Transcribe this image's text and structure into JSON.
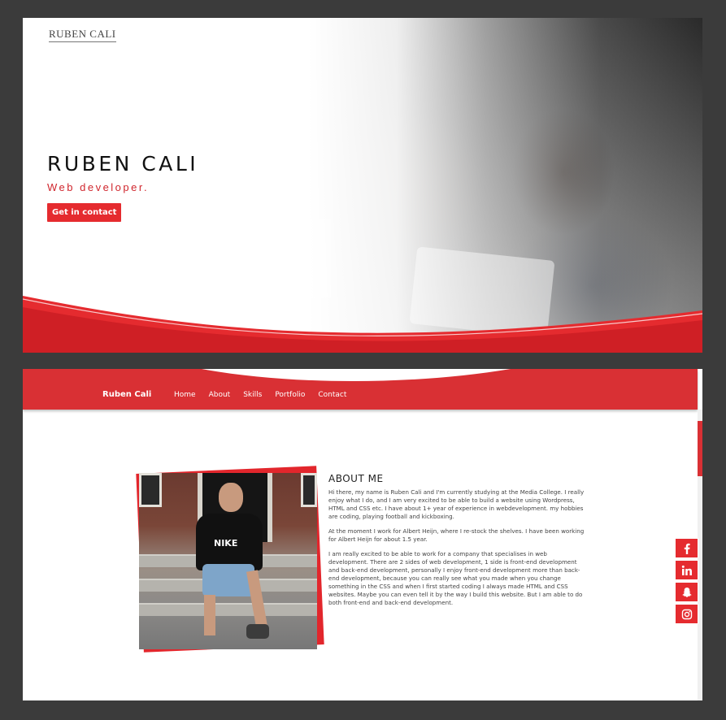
{
  "hero": {
    "logo": "RUBEN CALI",
    "title": "RUBEN CALI",
    "subtitle": "Web developer.",
    "cta_label": "Get in contact"
  },
  "nav": {
    "brand": "Ruben Cali",
    "links": [
      "Home",
      "About",
      "Skills",
      "Portfolio",
      "Contact"
    ]
  },
  "about": {
    "title": "ABOUT ME",
    "paragraphs": [
      "Hi there, my name is Ruben Cali and I'm currently studying at the Media College. I really enjoy what I do, and I am very excited to be able to build a website using Wordpress, HTML and CSS etc. I have about 1+ year of experience in webdevelopment. my hobbies are coding, playing football and kickboxing.",
      "At the moment I work for Albert Heijn, where I re-stock the shelves. I have been working for Albert Heijn for about 1.5 year.",
      "I am really excited to be able to work for a company that specialises in web development. There are 2 sides of web development, 1 side is front-end development and back-end development, personally I enjoy front-end development more than back-end development, because you can really see what you made when you change something in the CSS and when I first started coding I always made HTML and CSS websites. Maybe you can even tell it by the way I build this website. But I am able to do both front-end and back-end development."
    ],
    "photo_shirt_text": "NIKE"
  },
  "social": [
    "facebook-icon",
    "linkedin-icon",
    "snapchat-icon",
    "instagram-icon"
  ],
  "colors": {
    "accent": "#e52b2f",
    "nav_bg": "#d93034",
    "page_bg": "#3b3b3b"
  }
}
